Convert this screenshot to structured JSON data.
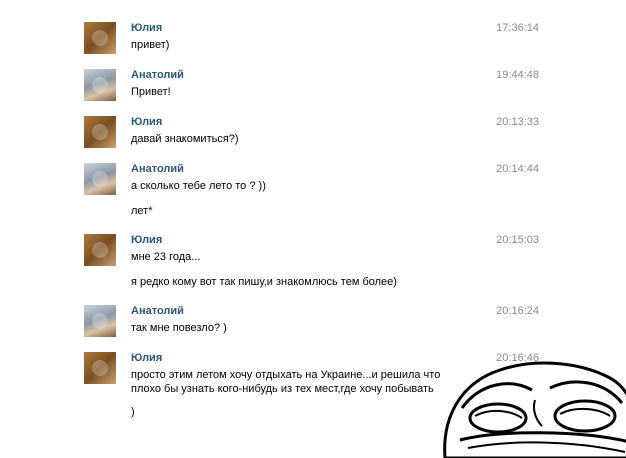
{
  "messages": [
    {
      "author": "Юлия",
      "time": "17:36:14",
      "lines": [
        "привет)"
      ]
    },
    {
      "author": "Анатолий",
      "time": "19:44:48",
      "lines": [
        "Привет!"
      ]
    },
    {
      "author": "Юлия",
      "time": "20:13:33",
      "lines": [
        "давай знакомиться?)"
      ]
    },
    {
      "author": "Анатолий",
      "time": "20:14:44",
      "lines": [
        "а сколько тебе лето то ? ))",
        "лет*"
      ]
    },
    {
      "author": "Юлия",
      "time": "20:15:03",
      "lines": [
        "мне 23 года...",
        "я редко кому вот так пишу,и знакомлюсь тем более)"
      ]
    },
    {
      "author": "Анатолий",
      "time": "20:16:24",
      "lines": [
        "так мне повезло? )"
      ]
    },
    {
      "author": "Юлия",
      "time": "20:16:46",
      "lines": [
        "просто этим летом хочу отдыхать на Украине...и решила что",
        "плохо бы узнать кого-нибудь из тех мест,где хочу побывать",
        ")"
      ]
    }
  ]
}
